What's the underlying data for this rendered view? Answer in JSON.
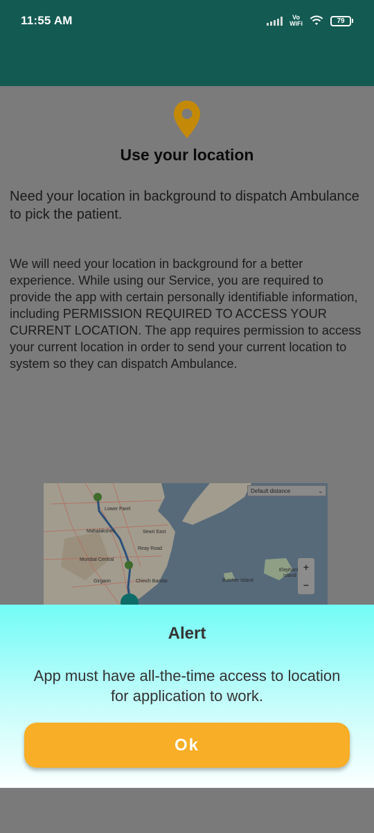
{
  "status_bar": {
    "time": "11:55 AM",
    "network_label_top": "Vo",
    "network_label_bottom": "WiFi",
    "battery": "79"
  },
  "permission_screen": {
    "title": "Use your location",
    "short_text": "Need your location in background to dispatch Ambulance to pick the patient.",
    "long_text": "We will need your location in background for a better experience. While using our Service, you are required to provide the app with certain personally identifiable information, including PERMISSION REQUIRED TO ACCESS YOUR CURRENT LOCATION. The app requires permission to access your current location in order to send your current location to system so they can dispatch Ambulance.",
    "map": {
      "distance_select": "Default distance",
      "labels": {
        "lower_parel": "Lower Parel",
        "mahalakshmi": "Mahalakshmi",
        "sewri_east": "Sewri East",
        "reay_road": "Reay Road",
        "mumbai_central": "Mumbai Central",
        "girgaon": "Girgaon",
        "chinch_bandar": "Chinch Bandar",
        "butcher_island": "Butcher Island",
        "elephanta_1": "Elephant",
        "elephanta_2": "Island"
      },
      "zoom_in": "+",
      "zoom_out": "−"
    }
  },
  "alert": {
    "title": "Alert",
    "message": "App must have all-the-time access to location for application to work.",
    "ok_label": "Ok"
  },
  "colors": {
    "header": "#135a52",
    "pin": "#c48a07",
    "button": "#f8ae26",
    "dialog_top": "#72fcf6"
  }
}
